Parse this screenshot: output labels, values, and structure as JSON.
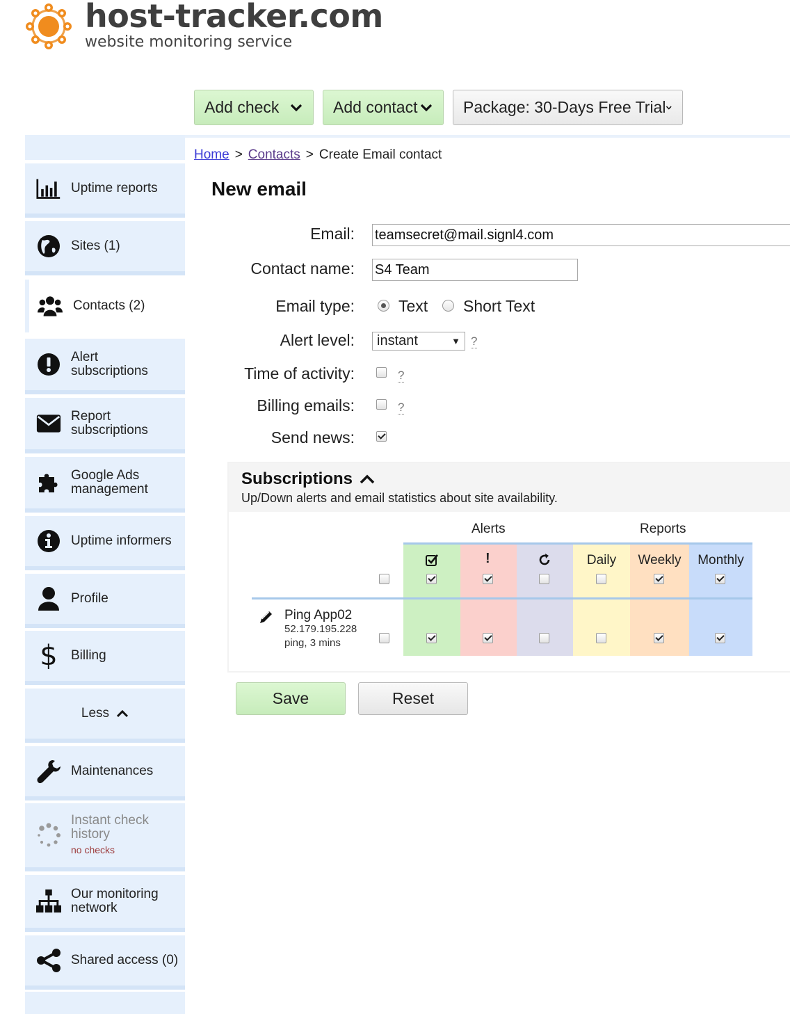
{
  "brand": {
    "title": "host-tracker.com",
    "subtitle": "website monitoring service",
    "accent": "#f08c1e"
  },
  "toolbar": {
    "add_check": "Add check",
    "add_contact": "Add contact",
    "package": "Package: 30-Days Free Trial"
  },
  "sidebar": {
    "items": [
      {
        "label": "Uptime reports",
        "icon": "bar-chart-icon"
      },
      {
        "label": "Sites (1)",
        "icon": "globe-icon"
      },
      {
        "label": "Contacts (2)",
        "icon": "users-icon",
        "active": true
      },
      {
        "label": "Alert subscriptions",
        "icon": "exclamation-icon"
      },
      {
        "label": "Report subscriptions",
        "icon": "envelope-icon"
      },
      {
        "label": "Google Ads management",
        "icon": "puzzle-icon"
      },
      {
        "label": "Uptime informers",
        "icon": "info-icon"
      },
      {
        "label": "Profile",
        "icon": "user-icon"
      },
      {
        "label": "Billing",
        "icon": "dollar-icon"
      },
      {
        "label": "Less",
        "icon": "chevron-up-icon"
      },
      {
        "label": "Maintenances",
        "icon": "wrench-icon"
      },
      {
        "label": "Instant check history",
        "sub": "no checks",
        "icon": "spinner-icon"
      },
      {
        "label": "Our monitoring network",
        "icon": "network-icon"
      },
      {
        "label": "Shared access (0)",
        "icon": "share-icon"
      }
    ]
  },
  "breadcrumb": {
    "home": "Home",
    "contacts": "Contacts",
    "current": "Create Email contact",
    "sep": ">"
  },
  "page": {
    "title": "New email"
  },
  "form": {
    "email_label": "Email:",
    "email_value": "teamsecret@mail.signl4.com",
    "name_label": "Contact name:",
    "name_value": "S4 Team",
    "type_label": "Email type:",
    "type_options": [
      "Text",
      "Short Text"
    ],
    "type_selected": "Text",
    "level_label": "Alert level:",
    "level_value": "instant",
    "activity_label": "Time of activity:",
    "activity_checked": false,
    "billing_label": "Billing emails:",
    "billing_checked": false,
    "news_label": "Send news:",
    "news_checked": true,
    "help": "?"
  },
  "subscriptions": {
    "title": "Subscriptions",
    "description": "Up/Down alerts and email statistics about site availability.",
    "alerts_label": "Alerts",
    "reports_label": "Reports",
    "columns": [
      {
        "key": "up",
        "header_icon": "check-square-icon",
        "color": "#cdf0c2",
        "header_checked": true,
        "row_checked": true
      },
      {
        "key": "down",
        "header_icon": "exclamation-mark-icon",
        "header_text": "!",
        "color": "#fbd0cc",
        "header_checked": true,
        "row_checked": true
      },
      {
        "key": "repeat",
        "header_icon": "refresh-icon",
        "color": "#dcdcec",
        "header_checked": false,
        "row_checked": false
      },
      {
        "key": "daily",
        "header_text": "Daily",
        "color": "#fff6c8",
        "header_checked": false,
        "row_checked": false
      },
      {
        "key": "weekly",
        "header_text": "Weekly",
        "color": "#ffe0c1",
        "header_checked": true,
        "row_checked": true
      },
      {
        "key": "monthly",
        "header_text": "Monthly",
        "color": "#c8dcfa",
        "header_checked": true,
        "row_checked": true
      }
    ],
    "all_checked": false,
    "site": {
      "name": "Ping App02",
      "ip": "52.179.195.228",
      "info": "ping, 3 mins",
      "row_all_checked": false
    }
  },
  "actions": {
    "save": "Save",
    "reset": "Reset"
  }
}
